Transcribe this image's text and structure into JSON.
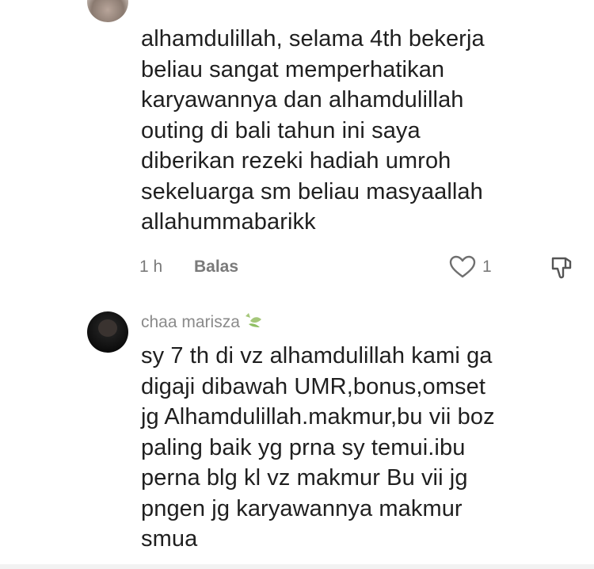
{
  "comments": [
    {
      "text": "alhamdulillah, selama 4th bekerja\nbeliau sangat memperhatikan\nkaryawannya dan alhamdulillah\nouting di bali tahun ini saya\ndiberikan rezeki hadiah umroh\nsekeluarga sm beliau masyaallah\nallahummabarikk",
      "time": "1 h",
      "reply_label": "Balas",
      "like_count": "1"
    },
    {
      "username": "chaa marisza",
      "username_emoji": "sparkle-leaf-icon",
      "text": "sy 7 th di vz alhamdulillah kami ga\ndigaji dibawah UMR,bonus,omset\njg Alhamdulillah.makmur,bu vii boz\npaling baik yg prna sy temui.ibu\nperna blg kl vz makmur Bu vii jg\npngen jg karyawannya makmur\nsmua"
    }
  ],
  "colors": {
    "text": "#1f1f1f",
    "meta": "#7a7a7a",
    "username": "#8a8a8a",
    "accent_emoji": "#a5c77a"
  }
}
